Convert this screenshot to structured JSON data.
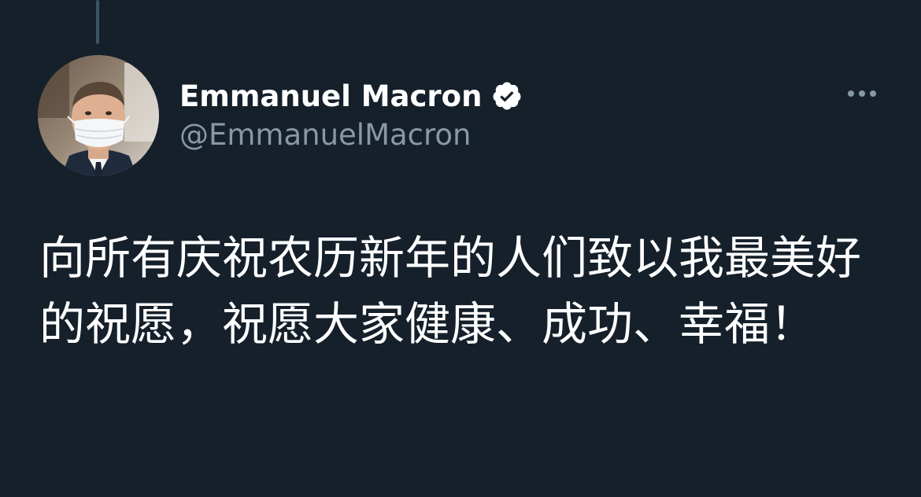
{
  "tweet": {
    "author_name": "Emmanuel Macron",
    "handle": "@EmmanuelMacron",
    "verified": true,
    "text": "向所有庆祝农历新年的人们致以我最美好的祝愿，祝愿大家健康、成功、幸福！"
  },
  "icons": {
    "verified": "verified-badge-icon",
    "more": "more-horizontal-icon"
  },
  "colors": {
    "background": "#15202b",
    "primary_text": "#ffffff",
    "secondary_text": "#8899a6",
    "thread_line": "#3d5466"
  }
}
